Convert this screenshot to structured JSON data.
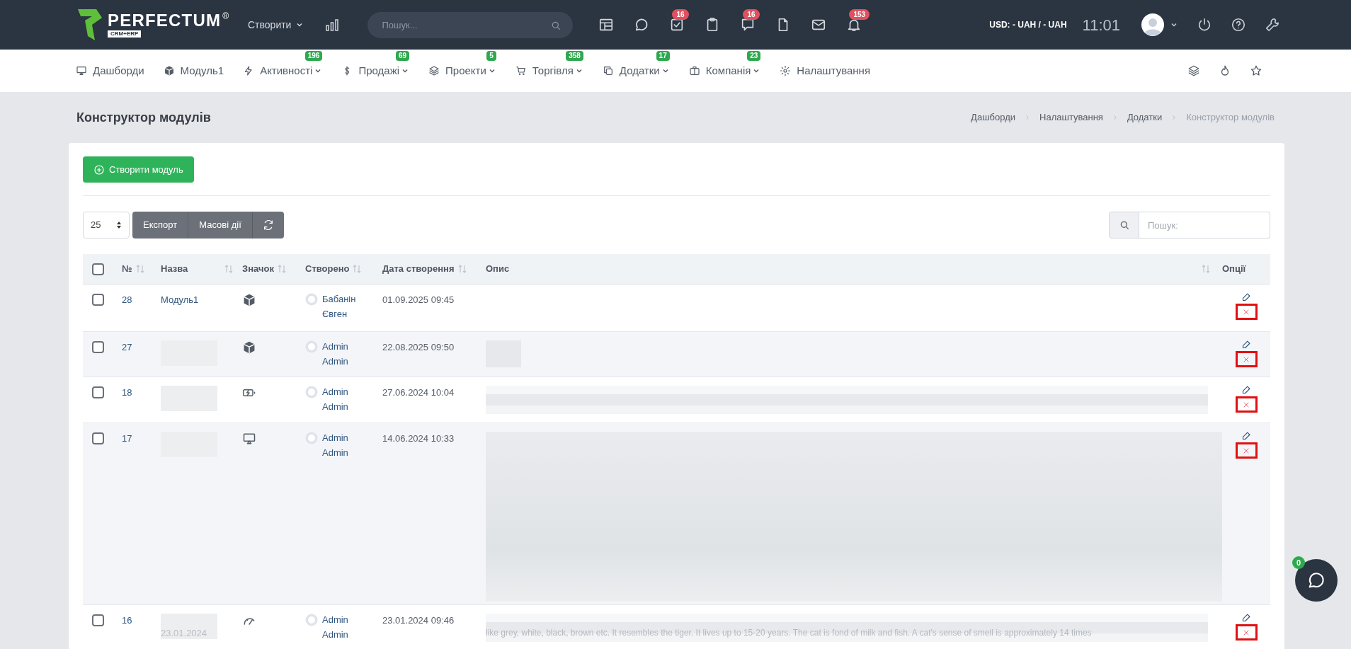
{
  "topbar": {
    "logo": "PERFECTUM",
    "logo_mark": "®",
    "logo_sub": "CRM+ERP",
    "create_menu": "Створити",
    "search": {
      "placeholder": "Пошук..."
    },
    "icons": [
      {
        "kind": "layout"
      },
      {
        "kind": "chat"
      },
      {
        "kind": "task",
        "badge": "16"
      },
      {
        "kind": "clipboard"
      },
      {
        "kind": "message",
        "badge": "16"
      },
      {
        "kind": "file"
      },
      {
        "kind": "mail"
      },
      {
        "kind": "bell",
        "badge": "153"
      }
    ],
    "currency": "USD: - UAH / - UAH",
    "time": "11:01"
  },
  "nav": {
    "items": [
      {
        "kind": "dashboard",
        "label": "Дашборди",
        "dropdown": false
      },
      {
        "kind": "box",
        "label": "Модуль1",
        "dropdown": false
      },
      {
        "kind": "bolt",
        "label": "Активності",
        "badge": "196",
        "dropdown": true
      },
      {
        "kind": "dollar",
        "label": "Продажі",
        "badge": "69",
        "dropdown": true
      },
      {
        "kind": "layers",
        "label": "Проекти",
        "badge": "5",
        "dropdown": true
      },
      {
        "kind": "cart",
        "label": "Торгівля",
        "badge": "358",
        "dropdown": true
      },
      {
        "kind": "copy",
        "label": "Додатки",
        "badge": "17",
        "dropdown": true
      },
      {
        "kind": "briefcase",
        "label": "Компанія",
        "badge": "23",
        "dropdown": true
      },
      {
        "kind": "gear",
        "label": "Налаштування",
        "dropdown": false
      }
    ]
  },
  "page": {
    "title": "Конструктор модулів",
    "breadcrumbs": [
      "Дашборди",
      "Налаштування",
      "Додатки",
      "Конструктор модулів"
    ]
  },
  "toolbar": {
    "create_button": "Створити модуль",
    "page_size": "25",
    "buttons": [
      "Експорт",
      "Масові дії"
    ],
    "search": {
      "placeholder": "Пошук:"
    }
  },
  "table": {
    "select_all_checked": false,
    "columns": [
      "№",
      "Назва",
      "Значок",
      "Створено",
      "Дата створення",
      "Опис",
      "Опції"
    ],
    "rows": [
      {
        "checked": false,
        "number": "28",
        "name": "Модуль1",
        "kind": "box",
        "author": [
          "Бабанін",
          "Євген"
        ],
        "date": "01.09.2025 09:45"
      },
      {
        "checked": false,
        "number": "27",
        "kind": "box",
        "author": [
          "Admin",
          "Admin"
        ],
        "date": "22.08.2025 09:50"
      },
      {
        "checked": false,
        "number": "18",
        "kind": "battery",
        "author": [
          "Admin",
          "Admin"
        ],
        "date": "27.06.2024 10:04"
      },
      {
        "checked": false,
        "number": "17",
        "kind": "screen",
        "author": [
          "Admin",
          "Admin"
        ],
        "date": "14.06.2024 10:33"
      },
      {
        "checked": false,
        "number": "16",
        "name": "23.01.2024",
        "kind": "gauge",
        "author": [
          "Admin",
          "Admin"
        ],
        "date": "23.01.2024 09:46",
        "description": "like grey, white, black, brown etc. It resembles the tiger. It lives up to 15-20 years. The cat is fond of milk and fish. A cat's sense of smell is approximately 14 times"
      }
    ]
  },
  "chat_widget": {
    "badge": "0"
  }
}
